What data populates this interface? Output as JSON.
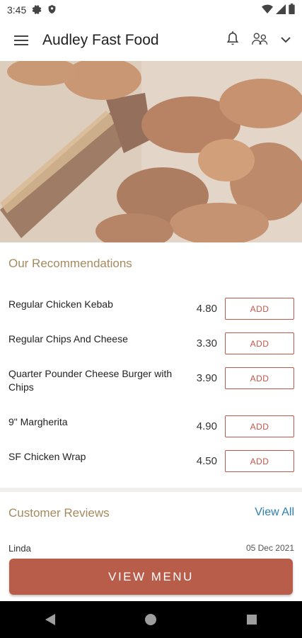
{
  "status_bar": {
    "time": "3:45",
    "icons": [
      "gear-icon",
      "shield-icon",
      "wifi-icon",
      "signal-icon",
      "battery-icon"
    ]
  },
  "app_bar": {
    "title": "Audley Fast Food",
    "icons": [
      "hamburger-menu-icon",
      "bell-icon",
      "people-icon",
      "chevron-down-icon"
    ]
  },
  "hero": {
    "image": "chicken-wings-with-basting-brush"
  },
  "recommendations": {
    "title": "Our Recommendations",
    "add_label": "ADD",
    "items": [
      {
        "name": "Regular Chicken Kebab",
        "price": "4.80"
      },
      {
        "name": "Regular Chips And Cheese",
        "price": "3.30"
      },
      {
        "name": "Quarter Pounder Cheese Burger with Chips",
        "price": "3.90"
      },
      {
        "name": "9\" Margherita",
        "price": "4.90"
      },
      {
        "name": "SF Chicken Wrap",
        "price": "4.50"
      }
    ]
  },
  "reviews": {
    "title": "Customer Reviews",
    "view_all": "View All",
    "first_review": {
      "name": "Linda",
      "date": "05 Dec 2021"
    }
  },
  "cta": {
    "label": "VIEW MENU"
  },
  "nav": {
    "icons": [
      "back-icon",
      "home-icon",
      "recents-icon"
    ]
  },
  "colors": {
    "accent": "#b95d4b",
    "section_title": "#a48a5e",
    "link": "#2b7fb5"
  }
}
